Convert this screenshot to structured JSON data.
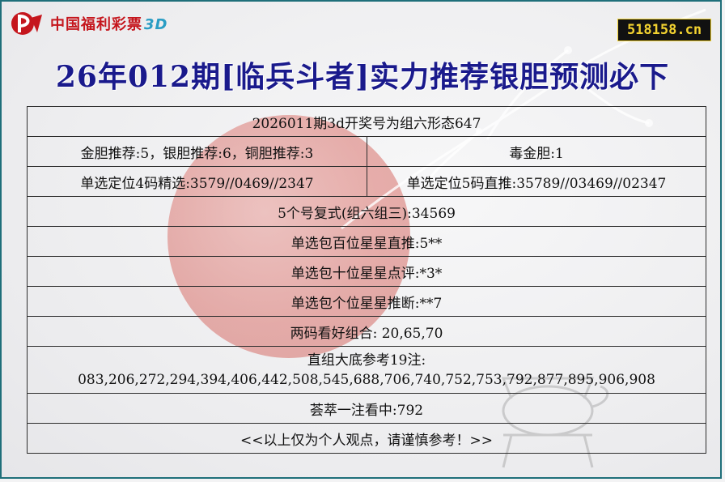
{
  "header": {
    "logo_text": "中国福利彩票",
    "logo_suffix": "3D",
    "site_badge": "518158.cn",
    "title": "26年012期[临兵斗者]实力推荐银胆预测必下"
  },
  "rows": {
    "draw_result": "2026011期3d开奖号为组六形态647",
    "gall_recommend": "金胆推荐:5，银胆推荐:6，铜胆推荐:3",
    "poison_gall": "毒金胆:1",
    "pos4": "单选定位4码精选:3579//0469//2347",
    "pos5": "单选定位5码直推:35789//03469//02347",
    "compound5": "5个号复式(组六组三):34569",
    "hundreds": "单选包百位星星直推:5**",
    "tens": "单选包十位星星点评:*3*",
    "units": "单选包个位星星推断:**7",
    "two_code": "两码看好组合: 20,65,70",
    "base_title": "直组大底参考19注:",
    "base_values": "083,206,272,294,394,406,442,508,545,688,706,740,752,753,792,877,895,906,908",
    "single_pick": "荟萃一注看中:792",
    "disclaimer": "<<以上仅为个人观点，请谨慎参考！>>"
  }
}
